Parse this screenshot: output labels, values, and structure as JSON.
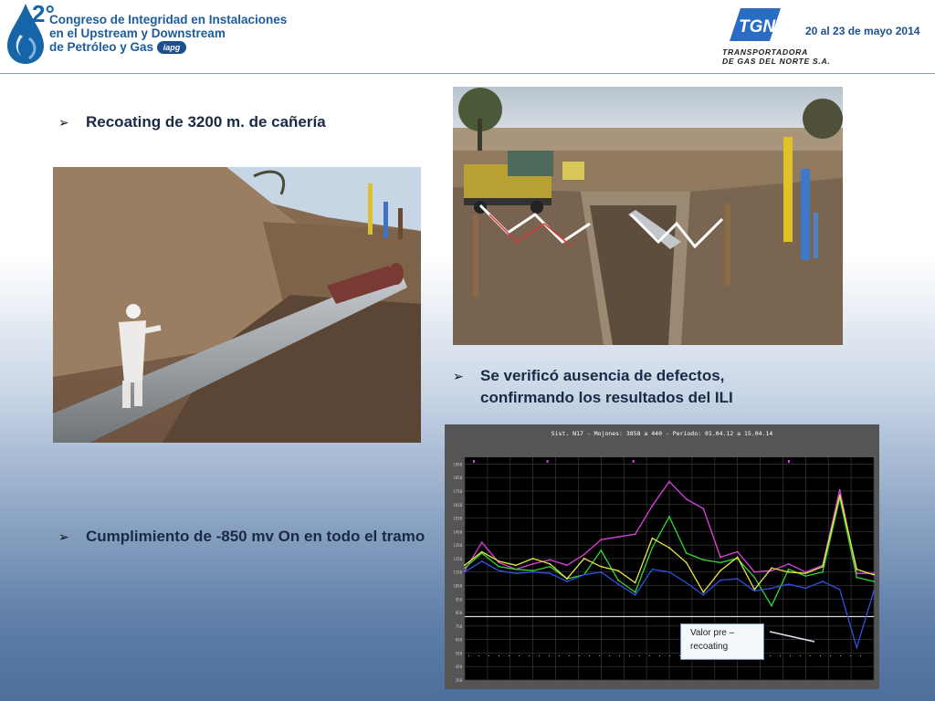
{
  "header": {
    "congress_number": "2°",
    "congress_title_lines": [
      "Congreso de Integridad en Instalaciones",
      "en el Upstream y Downstream",
      "de Petróleo y Gas"
    ],
    "iapg_badge": "iapg",
    "company_mark": "TGN",
    "company_name_lines": [
      "TRANSPORTADORA",
      "DE GAS DEL NORTE S.A."
    ],
    "event_date": "20 al 23 de mayo 2014",
    "colors": {
      "brand_blue": "#1d5c99",
      "drop_blue": "#1565a8",
      "tgn_blue": "#2a6cc4"
    }
  },
  "bullets": {
    "recoating": "Recoating de 3200 m. de cañería",
    "defects_line1": "Se verificó ausencia de defectos,",
    "defects_line2": "confirmando los resultados del ILI",
    "compliance": "Cumplimiento de -850 mv On en todo el tramo"
  },
  "photos": [
    {
      "subject": "worker in white suit coating a grey pipeline lying in a dug trench"
    },
    {
      "subject": "excavated trench with pipe, warning tapes, compressor truck and yellow marker posts"
    }
  ],
  "chart": {
    "title": "Sist. N17 - Mojones: 3858 a 440 - Periodo: 01.04.12 a 15.04.14",
    "annotation": "Valor pre – recoating",
    "colors": {
      "background": "#000000",
      "frame": "#555555",
      "grid": "#3a3a3a",
      "reference_line": "#d8d8d8",
      "annotation_pointer": "#d9e2ee"
    }
  },
  "chart_data": {
    "type": "line",
    "title": "Sist. N17 - Mojones: 3858 a 440 - Periodo: 01.04.12 a 15.04.14",
    "x_points": 25,
    "reference_level": 820,
    "ylim": [
      350,
      2000
    ],
    "y_ticks": [
      350,
      450,
      550,
      650,
      750,
      850,
      950,
      1050,
      1150,
      1250,
      1350,
      1450,
      1550,
      1650,
      1750,
      1850,
      1950
    ],
    "x_tick_count": 19,
    "series": [
      {
        "color": "#e040e0",
        "values": [
          1160,
          1370,
          1220,
          1170,
          1210,
          1240,
          1200,
          1280,
          1390,
          1410,
          1430,
          1640,
          1820,
          1690,
          1620,
          1260,
          1300,
          1150,
          1160,
          1210,
          1150,
          1200,
          1760,
          1140,
          1140
        ]
      },
      {
        "color": "#30d830",
        "values": [
          1180,
          1290,
          1190,
          1170,
          1160,
          1190,
          1100,
          1130,
          1310,
          1090,
          1000,
          1330,
          1560,
          1290,
          1240,
          1220,
          1250,
          1110,
          900,
          1170,
          1120,
          1150,
          1700,
          1110,
          1080
        ]
      },
      {
        "color": "#e8e840",
        "values": [
          1200,
          1300,
          1230,
          1200,
          1250,
          1210,
          1100,
          1250,
          1190,
          1160,
          1070,
          1400,
          1330,
          1220,
          1000,
          1160,
          1260,
          1020,
          1180,
          1150,
          1140,
          1190,
          1720,
          1170,
          1130
        ]
      },
      {
        "color": "#3050e0",
        "values": [
          1150,
          1230,
          1160,
          1140,
          1150,
          1140,
          1080,
          1130,
          1150,
          1060,
          980,
          1170,
          1150,
          1070,
          980,
          1090,
          1100,
          1010,
          1030,
          1060,
          1030,
          1080,
          1020,
          590,
          1010
        ]
      }
    ]
  }
}
